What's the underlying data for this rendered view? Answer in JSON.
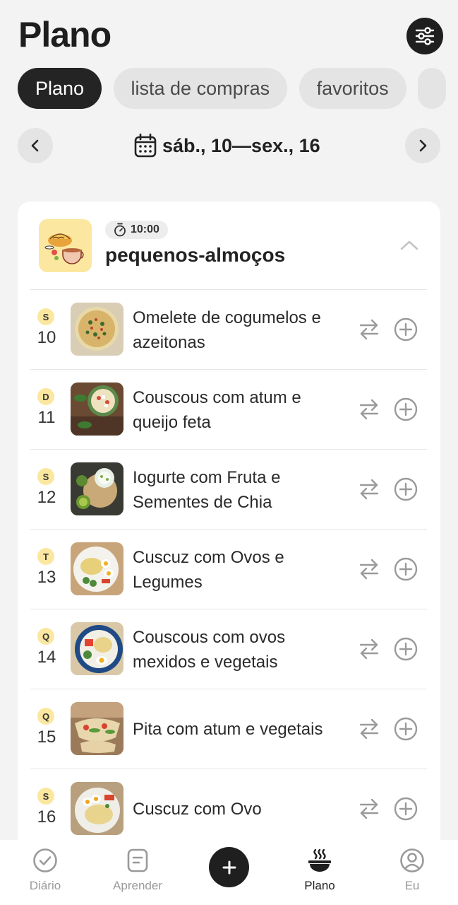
{
  "header": {
    "title": "Plano"
  },
  "icons": {
    "filter": "sliders-icon",
    "calendar": "calendar-icon",
    "timer": "stopwatch-icon"
  },
  "tabs": [
    {
      "label": "Plano",
      "active": true
    },
    {
      "label": "lista de compras",
      "active": false
    },
    {
      "label": "favoritos",
      "active": false
    }
  ],
  "week": {
    "label": "sáb., 10—sex., 16"
  },
  "meal": {
    "time": "10:00",
    "name": "pequenos-almoços",
    "rows": [
      {
        "day_letter": "S",
        "day_num": "10",
        "recipe": "Omelete de cogumelos e azeitonas"
      },
      {
        "day_letter": "D",
        "day_num": "11",
        "recipe": "Couscous com atum e queijo feta"
      },
      {
        "day_letter": "S",
        "day_num": "12",
        "recipe": "Iogurte com Fruta e Sementes de Chia"
      },
      {
        "day_letter": "T",
        "day_num": "13",
        "recipe": "Cuscuz com Ovos e Legumes"
      },
      {
        "day_letter": "Q",
        "day_num": "14",
        "recipe": "Couscous com ovos mexidos e vegetais"
      },
      {
        "day_letter": "Q",
        "day_num": "15",
        "recipe": "Pita com atum e vegetais"
      },
      {
        "day_letter": "S",
        "day_num": "16",
        "recipe": "Cuscuz com Ovo"
      }
    ]
  },
  "bottom_nav": [
    {
      "label": "Diário",
      "icon": "check-circle-icon",
      "active": false
    },
    {
      "label": "Aprender",
      "icon": "document-icon",
      "active": false
    },
    {
      "label": "",
      "icon": "plus-icon",
      "active": false
    },
    {
      "label": "Plano",
      "icon": "bowl-icon",
      "active": true
    },
    {
      "label": "Eu",
      "icon": "user-circle-icon",
      "active": false
    }
  ],
  "colors": {
    "accent_dark": "#1f1f1f",
    "day_badge": "#fbe7a0",
    "background": "#f3f3f3"
  }
}
